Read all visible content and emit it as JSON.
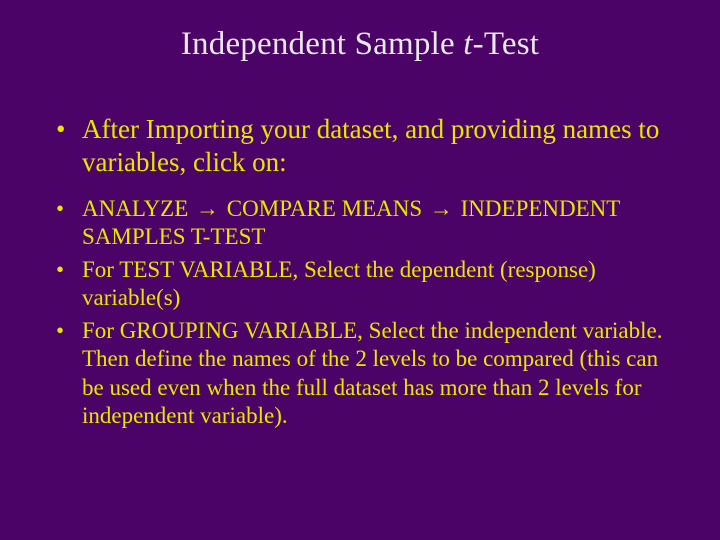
{
  "title_pre": "Independent Sample ",
  "title_italic": "t",
  "title_post": "-Test",
  "bullets": {
    "intro": "After Importing your dataset, and providing names to variables, click on:",
    "path_a": "ANALYZE ",
    "arrow": "→",
    "path_b": " COMPARE MEANS ",
    "path_c": " INDEPENDENT SAMPLES T-TEST",
    "testvar": "For TEST VARIABLE, Select the dependent (response) variable(s)",
    "groupvar": "For GROUPING VARIABLE, Select the independent variable. Then define the names of the 2 levels to be compared (this can be used even when the full dataset has more than 2 levels for independent variable)."
  }
}
